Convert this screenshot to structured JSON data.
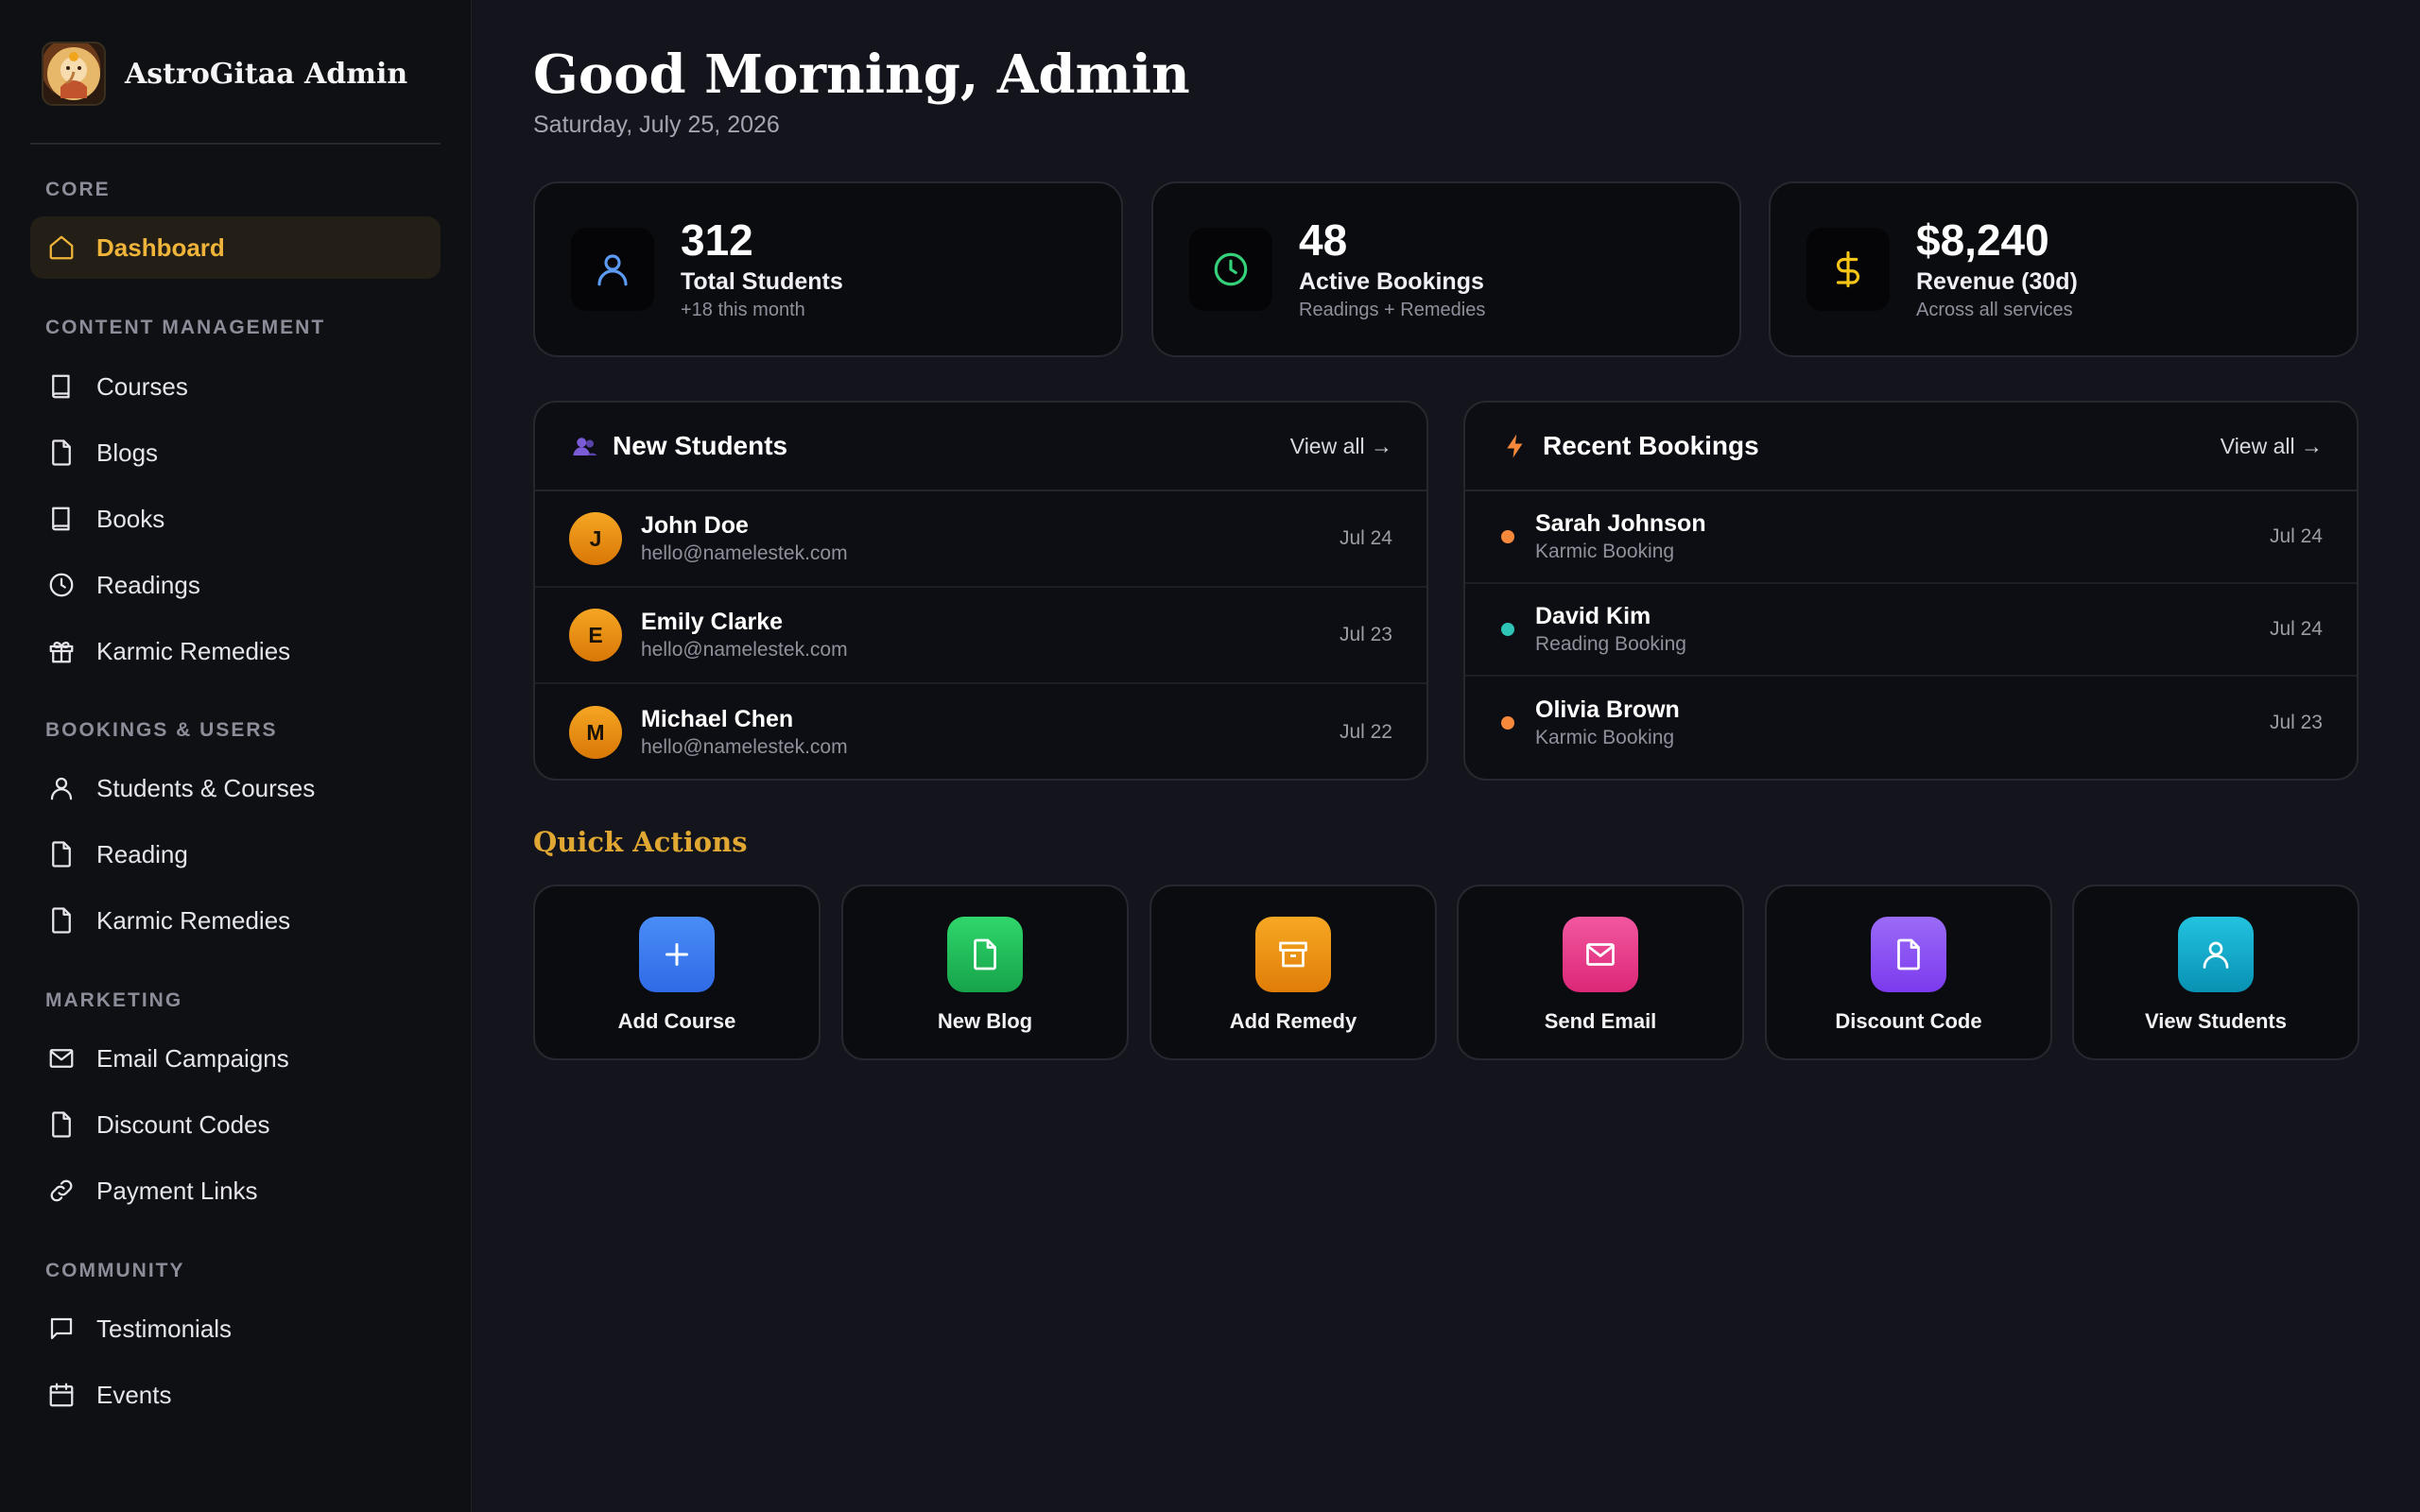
{
  "brand": {
    "title": "AstroGitaa Admin",
    "logo_icon": "ganesha-logo"
  },
  "sidebar": {
    "sections": [
      {
        "label": "CORE"
      },
      {
        "label": "CONTENT MANAGEMENT"
      },
      {
        "label": "BOOKINGS & USERS"
      },
      {
        "label": "MARKETING"
      },
      {
        "label": "COMMUNITY"
      }
    ],
    "items": [
      {
        "label": "Dashboard",
        "icon": "home-icon",
        "active": true
      },
      {
        "label": "Courses",
        "icon": "book-icon"
      },
      {
        "label": "Blogs",
        "icon": "file-icon"
      },
      {
        "label": "Books",
        "icon": "book-icon"
      },
      {
        "label": "Readings",
        "icon": "clock-icon"
      },
      {
        "label": "Karmic Remedies",
        "icon": "gift-icon"
      },
      {
        "label": "Students & Courses",
        "icon": "user-icon"
      },
      {
        "label": "Reading",
        "icon": "file-icon"
      },
      {
        "label": "Karmic Remedies",
        "icon": "file-icon"
      },
      {
        "label": "Email Campaigns",
        "icon": "mail-icon"
      },
      {
        "label": "Discount Codes",
        "icon": "file-icon"
      },
      {
        "label": "Payment Links",
        "icon": "link-icon"
      },
      {
        "label": "Testimonials",
        "icon": "message-icon"
      },
      {
        "label": "Events",
        "icon": "calendar-icon"
      }
    ]
  },
  "header": {
    "greeting": "Good Morning, Admin",
    "date": "Saturday, July 25, 2026"
  },
  "stats": [
    {
      "value": "312",
      "label": "Total Students",
      "sub": "+18 this month",
      "icon": "user-icon",
      "color": "#5b9bf5"
    },
    {
      "value": "48",
      "label": "Active Bookings",
      "sub": "Readings + Remedies",
      "icon": "clock-icon",
      "color": "#34d17a"
    },
    {
      "value": "$8,240",
      "label": "Revenue (30d)",
      "sub": "Across all services",
      "icon": "dollar-icon",
      "color": "#f5c518"
    }
  ],
  "new_students": {
    "title": "New Students",
    "link": "View all →",
    "rows": [
      {
        "initial": "J",
        "name": "John Doe",
        "email": "hello@namelestek.com",
        "date": "Jul 24"
      },
      {
        "initial": "E",
        "name": "Emily Clarke",
        "email": "hello@namelestek.com",
        "date": "Jul 23"
      },
      {
        "initial": "M",
        "name": "Michael Chen",
        "email": "hello@namelestek.com",
        "date": "Jul 22"
      }
    ]
  },
  "recent_bookings": {
    "title": "Recent Bookings",
    "link": "View all →",
    "rows": [
      {
        "name": "Sarah Johnson",
        "type": "Karmic Booking",
        "date": "Jul 24",
        "color": "#f5883a"
      },
      {
        "name": "David Kim",
        "type": "Reading Booking",
        "date": "Jul 24",
        "color": "#2ec4b6"
      },
      {
        "name": "Olivia Brown",
        "type": "Karmic Booking",
        "date": "Jul 23",
        "color": "#f5883a"
      }
    ]
  },
  "quick_actions": {
    "title": "Quick Actions",
    "items": [
      {
        "label": "Add Course",
        "icon": "plus-icon",
        "color": "#3b7cf5"
      },
      {
        "label": "New Blog",
        "icon": "file-icon",
        "color": "#22c55e"
      },
      {
        "label": "Add Remedy",
        "icon": "archive-icon",
        "color": "#f29a0e"
      },
      {
        "label": "Send Email",
        "icon": "mail-icon",
        "color": "#ec4899"
      },
      {
        "label": "Discount Code",
        "icon": "file-icon",
        "color": "#8b5cf6"
      },
      {
        "label": "View Students",
        "icon": "user-icon",
        "color": "#14b8d6"
      }
    ]
  }
}
